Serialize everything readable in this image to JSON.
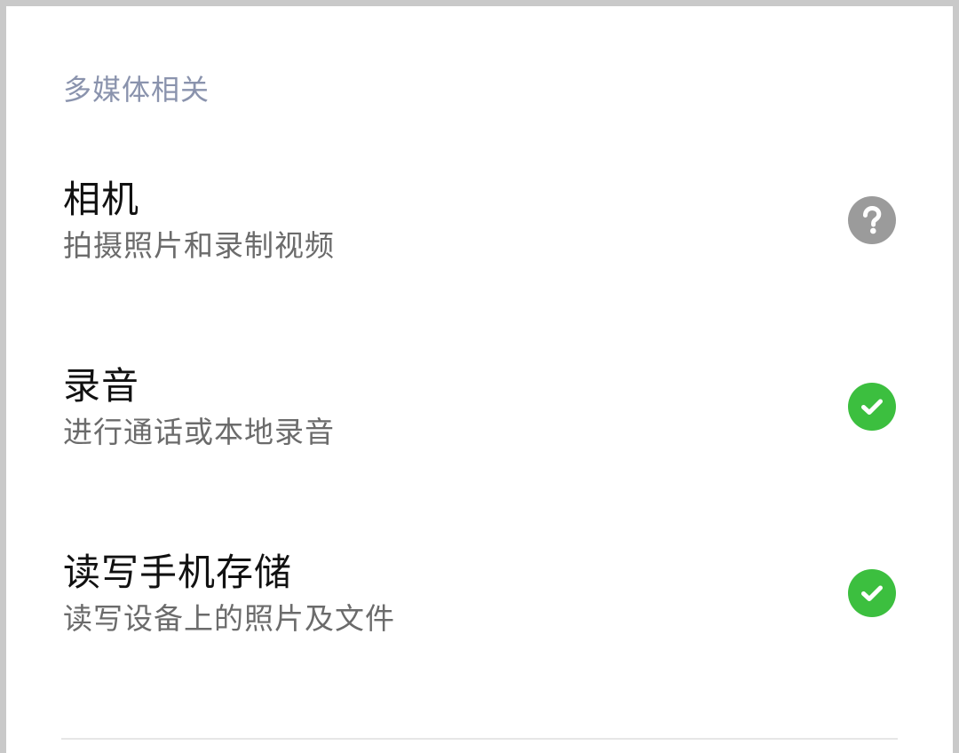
{
  "section": {
    "title": "多媒体相关"
  },
  "permissions": [
    {
      "title": "相机",
      "description": "拍摄照片和录制视频",
      "status": "unknown",
      "icon": "question-icon",
      "color": "#9b9b9b"
    },
    {
      "title": "录音",
      "description": "进行通话或本地录音",
      "status": "granted",
      "icon": "check-icon",
      "color": "#3cbf3f"
    },
    {
      "title": "读写手机存储",
      "description": "读写设备上的照片及文件",
      "status": "granted",
      "icon": "check-icon",
      "color": "#3cbf3f"
    }
  ]
}
